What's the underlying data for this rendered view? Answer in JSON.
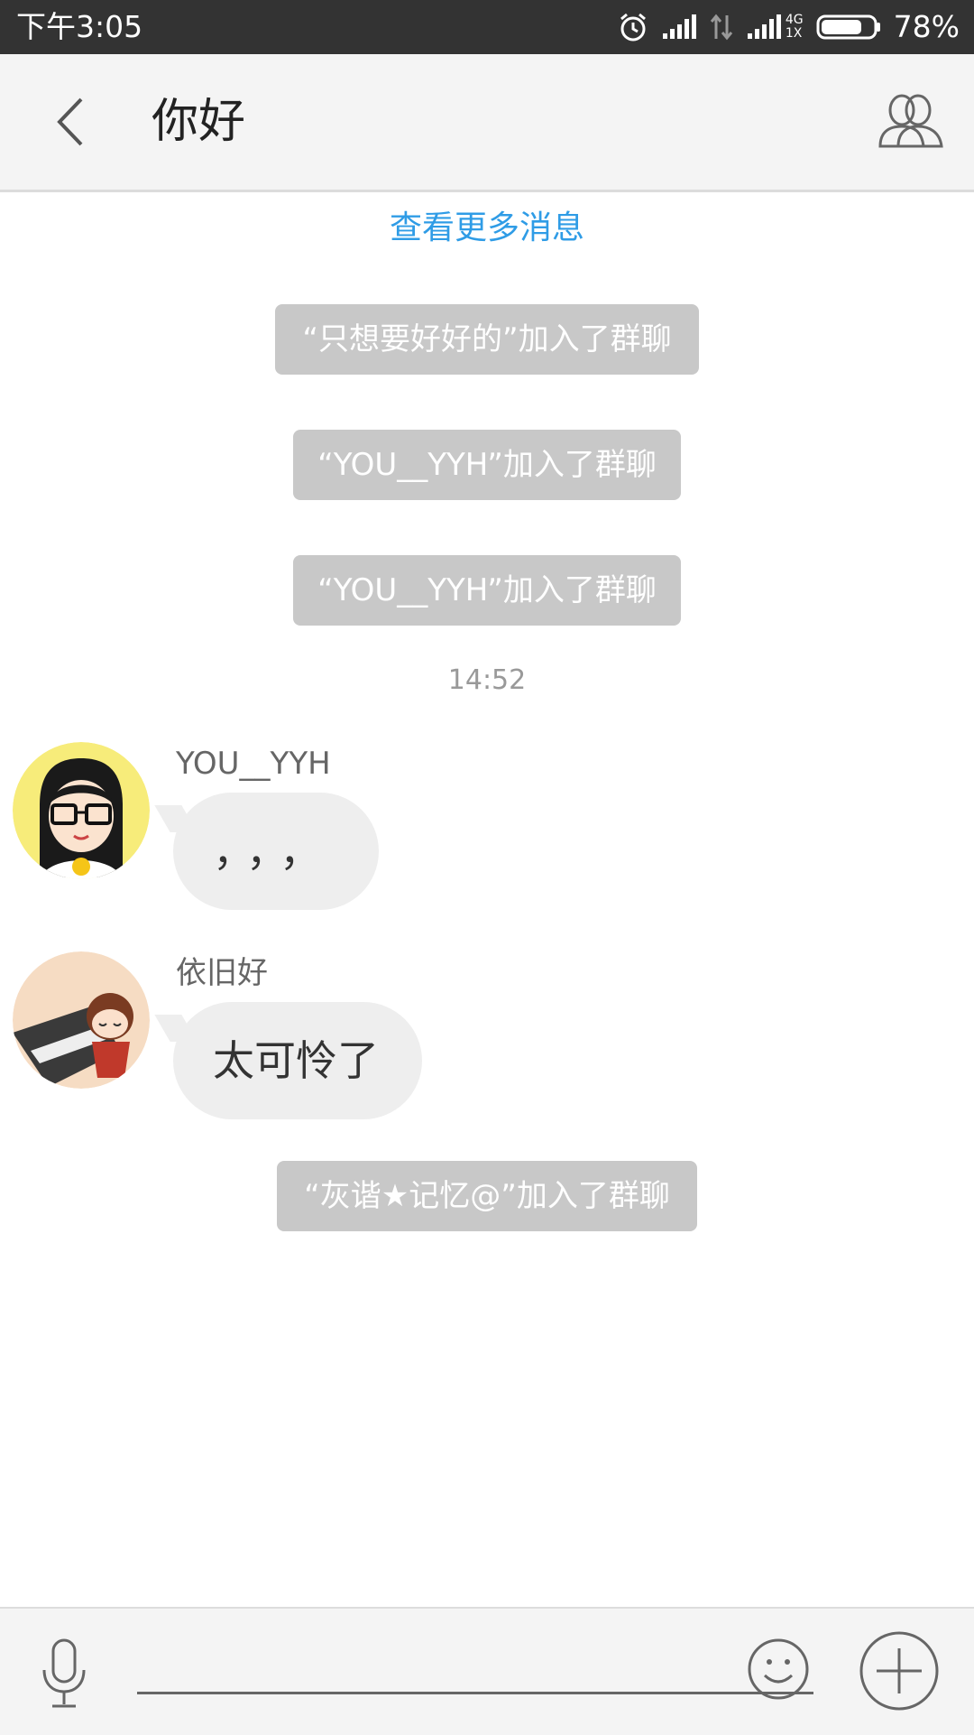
{
  "status_bar": {
    "time": "下午3:05",
    "network_type": "4G",
    "network_sub": "1X",
    "battery_percent": "78%",
    "battery_level": 0.78,
    "icons": [
      "alarm-icon",
      "signal-icon",
      "data-arrows-icon",
      "signal-4g-icon",
      "battery-icon"
    ]
  },
  "header": {
    "title": "你好",
    "back_icon": "chevron-left-icon",
    "members_icon": "group-members-icon"
  },
  "chat": {
    "load_more": "查看更多消息",
    "system_messages": [
      "“只想要好好的”加入了群聊",
      "“YOU__YYH”加入了群聊",
      "“YOU__YYH”加入了群聊",
      "“灰谐★记忆@”加入了群聊"
    ],
    "timestamp": "14:52",
    "messages": [
      {
        "sender": "YOU__YYH",
        "text": "，，，",
        "avatar": "cartoon-girl-glasses-avatar"
      },
      {
        "sender": "依旧好",
        "text": "太可怜了",
        "avatar": "cartoon-piano-avatar"
      }
    ]
  },
  "input_bar": {
    "value": "",
    "icons": [
      "microphone-icon",
      "emoji-icon",
      "plus-icon"
    ]
  },
  "colors": {
    "status_bar_bg": "#333333",
    "header_bg": "#f4f4f4",
    "link_blue": "#2f9ce6",
    "system_msg_bg": "#c8c8c8",
    "bubble_bg": "#eeeeee"
  }
}
